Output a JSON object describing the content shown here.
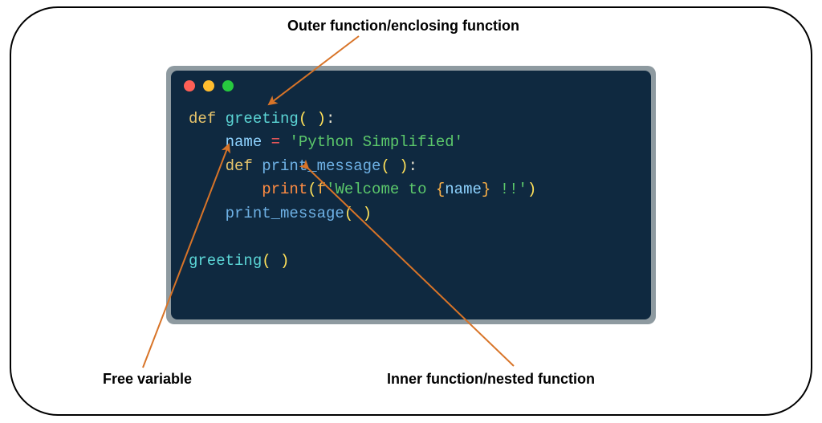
{
  "labels": {
    "outer_fn": "Outer function/enclosing function",
    "free_var": "Free variable",
    "inner_fn": "Inner function/nested function"
  },
  "code": {
    "line1_def": "def ",
    "line1_fn": "greeting",
    "line1_paren": "( )",
    "line1_colon": ":",
    "line2_indent": "    ",
    "line2_var": "name",
    "line2_eq": " = ",
    "line2_str": "'Python Simplified'",
    "line3_indent": "    ",
    "line3_def": "def ",
    "line3_fn": "print_message",
    "line3_paren": "( )",
    "line3_colon": ":",
    "line4_indent": "        ",
    "line4_print": "print",
    "line4_open": "(",
    "line4_f": "f",
    "line4_str1": "'Welcome to ",
    "line4_brace_open": "{",
    "line4_name": "name",
    "line4_brace_close": "}",
    "line4_str2": " !!'",
    "line4_close": ")",
    "line5_indent": "    ",
    "line5_call": "print_message",
    "line5_paren": "( )",
    "line7_call": "greeting",
    "line7_paren": "( )"
  },
  "colors": {
    "arrow": "#d87428"
  }
}
